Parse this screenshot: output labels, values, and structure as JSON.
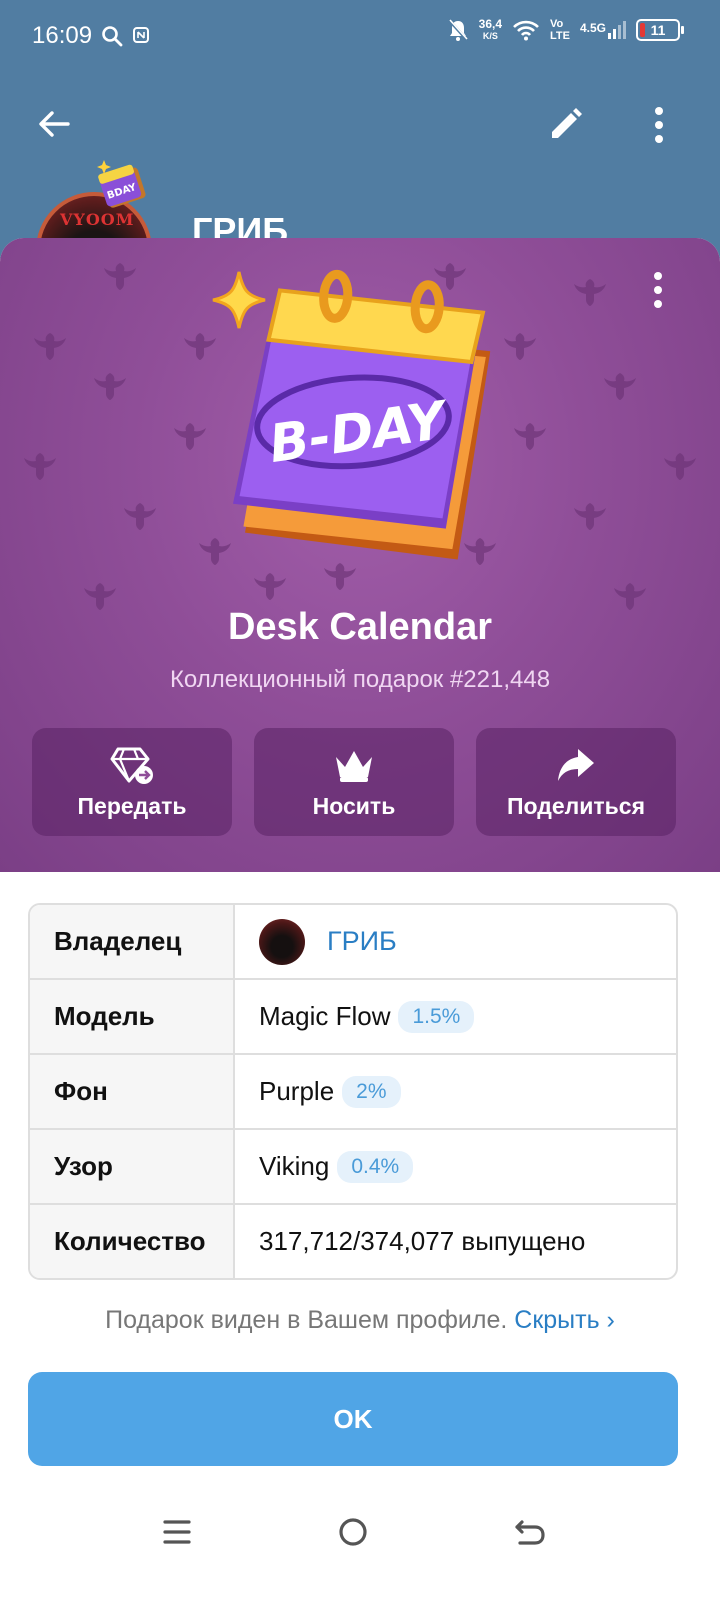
{
  "status_bar": {
    "time": "16:09",
    "speed_value": "36,4",
    "speed_unit": "K/S",
    "volte_top": "Vo",
    "volte_bottom": "LTE",
    "network": "4.5G",
    "battery": "11"
  },
  "profile": {
    "name": "ГРИБ",
    "avatar_text": "VYOOM"
  },
  "gift": {
    "art_text": "B-DAY",
    "title": "Desk Calendar",
    "subtitle": "Коллекционный подарок #221,448",
    "actions": [
      {
        "label": "Передать",
        "icon": "gem-transfer-icon"
      },
      {
        "label": "Носить",
        "icon": "crown-icon"
      },
      {
        "label": "Поделиться",
        "icon": "share-arrow-icon"
      }
    ]
  },
  "details": {
    "owner_label": "Владелец",
    "owner_name": "ГРИБ",
    "model_label": "Модель",
    "model_value": "Magic Flow",
    "model_pct": "1.5%",
    "backdrop_label": "Фон",
    "backdrop_value": "Purple",
    "backdrop_pct": "2%",
    "pattern_label": "Узор",
    "pattern_value": "Viking",
    "pattern_pct": "0.4%",
    "quantity_label": "Количество",
    "quantity_value": "317,712/374,077 выпущено"
  },
  "visibility": {
    "text": "Подарок виден в Вашем профиле.",
    "link": "Скрыть ›"
  },
  "ok_button": "OK",
  "colors": {
    "header": "#517da2",
    "hero": "#8f4e98",
    "accent": "#50a5e6",
    "link": "#2a7ec4"
  }
}
